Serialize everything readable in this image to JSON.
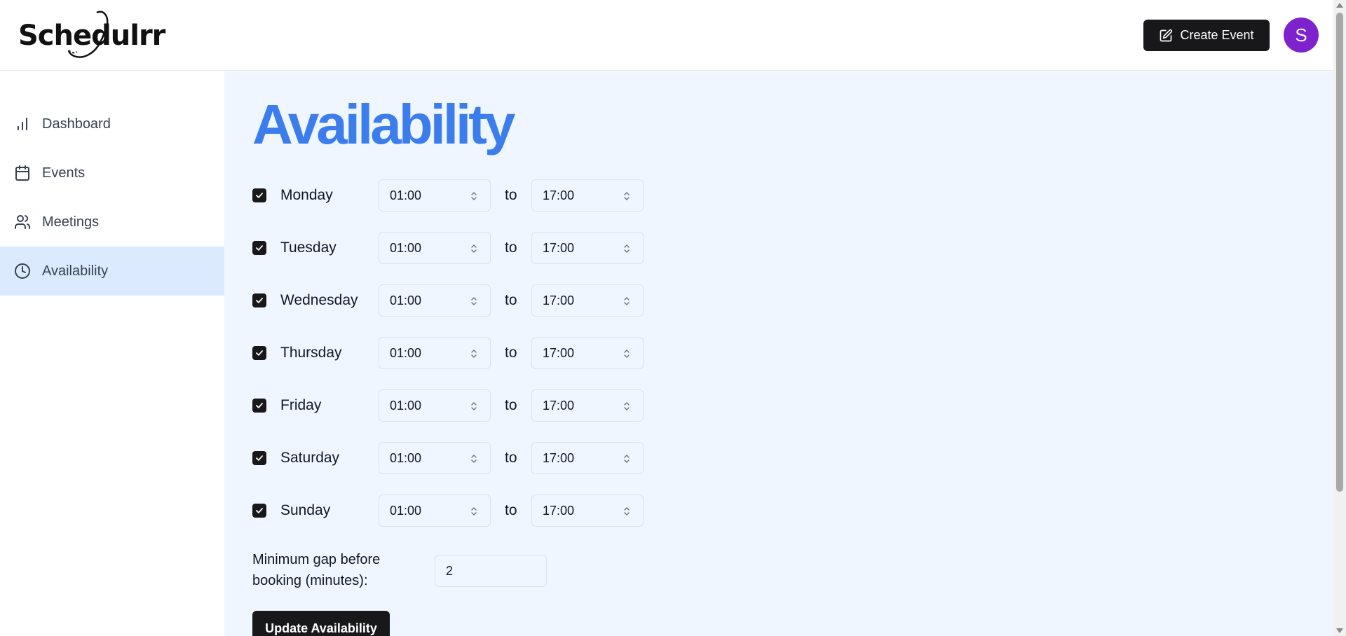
{
  "header": {
    "logo_text": "Schedulrr",
    "create_event_label": "Create Event",
    "avatar_initial": "S"
  },
  "sidebar": {
    "items": [
      {
        "label": "Dashboard",
        "icon": "bar-chart-icon",
        "active": false
      },
      {
        "label": "Events",
        "icon": "calendar-icon",
        "active": false
      },
      {
        "label": "Meetings",
        "icon": "users-icon",
        "active": false
      },
      {
        "label": "Availability",
        "icon": "clock-icon",
        "active": true
      }
    ]
  },
  "main": {
    "title": "Availability",
    "to_label": "to",
    "days": [
      {
        "name": "Monday",
        "checked": true,
        "from": "01:00",
        "to": "17:00"
      },
      {
        "name": "Tuesday",
        "checked": true,
        "from": "01:00",
        "to": "17:00"
      },
      {
        "name": "Wednesday",
        "checked": true,
        "from": "01:00",
        "to": "17:00"
      },
      {
        "name": "Thursday",
        "checked": true,
        "from": "01:00",
        "to": "17:00"
      },
      {
        "name": "Friday",
        "checked": true,
        "from": "01:00",
        "to": "17:00"
      },
      {
        "name": "Saturday",
        "checked": true,
        "from": "01:00",
        "to": "17:00"
      },
      {
        "name": "Sunday",
        "checked": true,
        "from": "01:00",
        "to": "17:00"
      }
    ],
    "gap_label": "Minimum gap before booking (minutes):",
    "gap_value": "2",
    "update_label": "Update Availability"
  },
  "colors": {
    "accent": "#3b7ded",
    "active_nav_bg": "#dbeafe",
    "main_bg": "#eff6ff",
    "button_bg": "#18181b",
    "avatar_bg": "#7e22ce"
  }
}
